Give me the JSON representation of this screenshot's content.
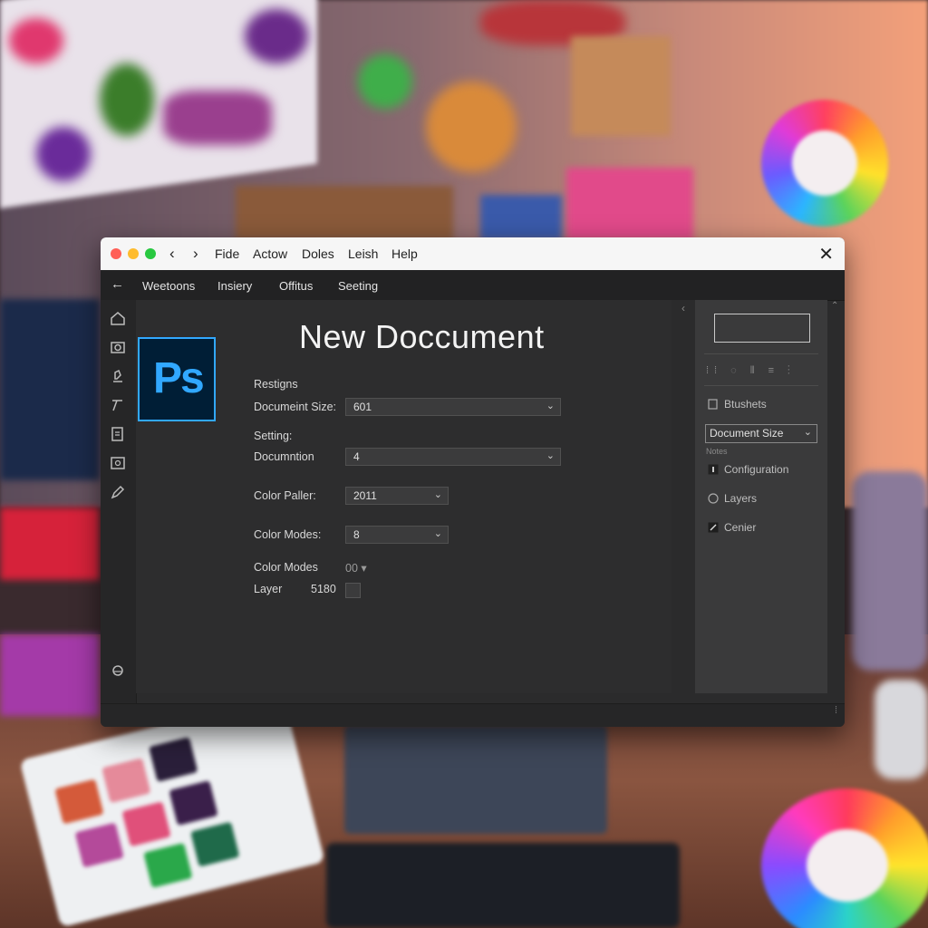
{
  "titlebar": {
    "menu": [
      "Fide",
      "Actow",
      "Doles",
      "Leish",
      "Help"
    ],
    "close_label": "✕",
    "traffic_colors": [
      "#ff5f57",
      "#febc2e",
      "#28c840"
    ]
  },
  "toolbar": {
    "tabs": [
      "Weetoons",
      "Insiery",
      "Offitus",
      "Seeting"
    ]
  },
  "app_logo": "Ps",
  "main": {
    "title": "New Doccument",
    "section1_label": "Restigns",
    "document_size_label": "Documeint Size:",
    "document_size_value": "601",
    "section2_label": "Setting:",
    "documention_label": "Documntion",
    "documention_value": "4",
    "color_palette_label": "Color Paller:",
    "color_palette_value": "2011",
    "color_modes_label": "Color Modes:",
    "color_modes_value": "8",
    "color_modes2_label": "Color Modes",
    "color_modes2_value": "00",
    "layer_label": "Layer",
    "layer_value": "5180"
  },
  "right_panel": {
    "brushes_label": "Btushets",
    "select_value": "Document Size",
    "notes_label": "Notes",
    "configuration_label": "Configuration",
    "layers_label": "Layers",
    "center_label": "Cenier"
  },
  "colors": {
    "accent_ps": "#31a8ff",
    "window_bg": "#2b2b2c",
    "titlebar_bg": "#f6f6f6"
  }
}
